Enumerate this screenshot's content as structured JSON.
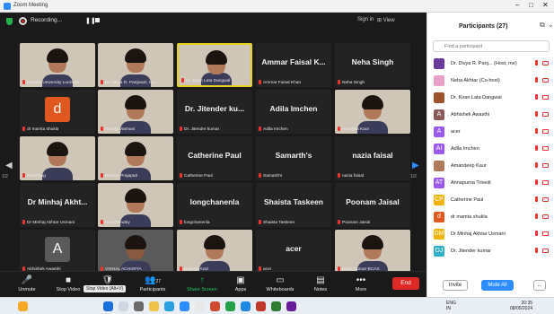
{
  "window": {
    "title": "Zoom Meeting",
    "controls": [
      "–",
      "□",
      "✕"
    ]
  },
  "meeting_header": {
    "recording_text": "Recording...",
    "sign_in": "Sign in",
    "view": "⊞ View"
  },
  "tiles": [
    {
      "type": "photo",
      "label": "Integral University Lucknow",
      "active": false,
      "shade": "light"
    },
    {
      "type": "photo",
      "label": "Dr. Divya R. Panjwani, Int...",
      "active": false,
      "shade": "light"
    },
    {
      "type": "photo",
      "label": "Dr. Kiran Lata Dangwal",
      "active": true,
      "shade": "light"
    },
    {
      "type": "name",
      "name": "Ammar Faisal K...",
      "label": "Ammar Faisal Khan"
    },
    {
      "type": "name",
      "name": "Neha Singh",
      "label": "Neha Singh"
    },
    {
      "type": "letter",
      "letter": "d",
      "color": "#e0571f",
      "label": "dr mamta shukla"
    },
    {
      "type": "photo",
      "label": "Srishty Vatmani",
      "active": false,
      "shade": "light"
    },
    {
      "type": "name",
      "name": "Dr. Jitender ku...",
      "label": "Dr. Jitender kumar"
    },
    {
      "type": "name",
      "name": "Adila Imchen",
      "label": "Adila Imchen"
    },
    {
      "type": "photo",
      "label": "Aashrika Kaur",
      "active": false,
      "shade": "light"
    },
    {
      "type": "photo",
      "label": "Aadil Nag",
      "active": false,
      "shade": "light"
    },
    {
      "type": "photo",
      "label": "Namrat Prajapati",
      "active": false,
      "shade": "light"
    },
    {
      "type": "name",
      "name": "Catherine Paul",
      "label": "Catherine Paul"
    },
    {
      "type": "name",
      "name": "Samarth's",
      "label": "Samarth's"
    },
    {
      "type": "name",
      "name": "nazia faisal",
      "label": "nazia faisal"
    },
    {
      "type": "name",
      "name": "Dr Minhaj Akht...",
      "label": "Dr Minhaj Akhtar Usmani"
    },
    {
      "type": "photo",
      "label": "Uma Pandey",
      "active": false,
      "shade": "light"
    },
    {
      "type": "name",
      "name": "longchanenla",
      "label": "longchanenla"
    },
    {
      "type": "name",
      "name": "Shaista Taskeen",
      "label": "Shaista Taskeen"
    },
    {
      "type": "name",
      "name": "Poonam Jaisal",
      "label": "Poonam Jaisal"
    },
    {
      "type": "letter",
      "letter": "A",
      "color": "#5a5a5a",
      "label": "Abhishek Awasthi"
    },
    {
      "type": "photo",
      "label": "VISHAL ACHARYA",
      "active": false,
      "shade": "dark"
    },
    {
      "type": "photo",
      "label": "Sayeda Azal",
      "active": false,
      "shade": "light"
    },
    {
      "type": "name",
      "name": "acer",
      "label": "acer"
    },
    {
      "type": "photo",
      "label": "Moriz Kumar BCAS",
      "active": false,
      "shade": "light"
    }
  ],
  "pager": {
    "left": "1/2",
    "right": "1/2"
  },
  "toolbar": {
    "items": [
      {
        "icon": "🎤",
        "label": "Unmute"
      },
      {
        "icon": "■",
        "label": "Stop Video"
      },
      {
        "icon": "🛡",
        "label": ""
      },
      {
        "icon": "👥",
        "label": "Participants",
        "count": "27"
      },
      {
        "icon": "↑",
        "label": "Share Screen"
      },
      {
        "icon": "▣",
        "label": "Apps"
      },
      {
        "icon": "▭",
        "label": "Whiteboards"
      },
      {
        "icon": "▤",
        "label": "Notes"
      },
      {
        "icon": "•••",
        "label": "More"
      }
    ],
    "tooltip": "Stop Video (Alt+V)",
    "end": "End"
  },
  "panel": {
    "title": "Participants (27)",
    "search_placeholder": "Find a participant",
    "participants": [
      {
        "initials": "",
        "color": "#6a3aa0",
        "name": "Dr. Divya R. Panj... (Host, me)"
      },
      {
        "initials": "",
        "color": "#e8a0c8",
        "name": "Neha Akhtar (Co-host)"
      },
      {
        "initials": "",
        "color": "#a0522d",
        "name": "Dr. Kiran Lata Dangwal"
      },
      {
        "initials": "A",
        "color": "#8a5a5a",
        "name": "Abhishek Awasthi"
      },
      {
        "initials": "A",
        "color": "#9b59f0",
        "name": "acer"
      },
      {
        "initials": "AI",
        "color": "#9b59f0",
        "name": "Adila Imchen"
      },
      {
        "initials": "",
        "color": "#b07a5a",
        "name": "Amandeep Kaur"
      },
      {
        "initials": "AT",
        "color": "#9b59f0",
        "name": "Annapurna Trivedi"
      },
      {
        "initials": "CP",
        "color": "#f0b400",
        "name": "Catherine Paul"
      },
      {
        "initials": "d",
        "color": "#e0571f",
        "name": "dr mamta shukla"
      },
      {
        "initials": "DM",
        "color": "#f0b400",
        "name": "Dr Minhaj Akhtar Usmani"
      },
      {
        "initials": "DJ",
        "color": "#2db0c8",
        "name": "Dr. Jitender kumar"
      }
    ],
    "invite": "Invite",
    "mute_all": "Mute All",
    "more": "..."
  },
  "taskbar": {
    "lang": "ENG",
    "region": "IN",
    "time": "20:35",
    "date": "08/05/2024"
  }
}
